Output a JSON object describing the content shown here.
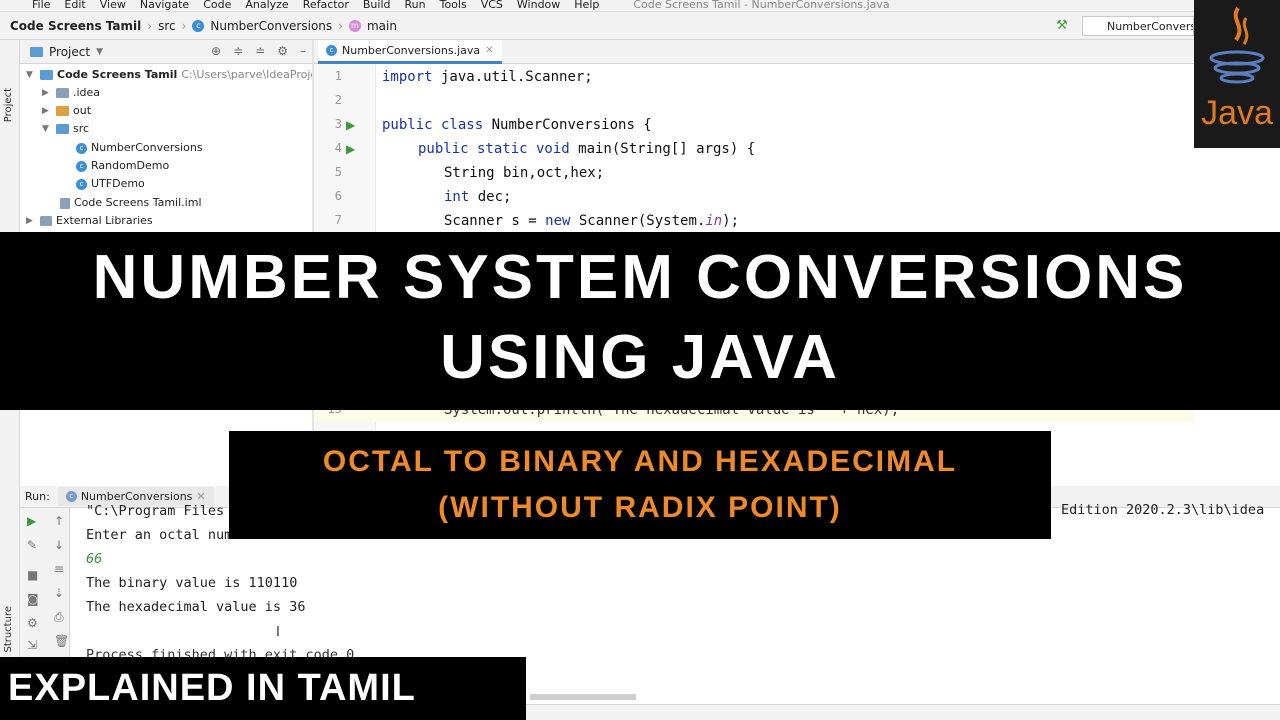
{
  "menu": {
    "items": [
      "File",
      "Edit",
      "View",
      "Navigate",
      "Code",
      "Analyze",
      "Refactor",
      "Build",
      "Run",
      "Tools",
      "VCS",
      "Window",
      "Help"
    ],
    "window_title": "Code Screens Tamil - NumberConversions.java"
  },
  "breadcrumb": {
    "project": "Code Screens Tamil",
    "src": "src",
    "class": "NumberConversions",
    "method": "main"
  },
  "run_config": "NumberConversions",
  "project_panel": {
    "title": "Project",
    "root": {
      "name": "Code Screens Tamil",
      "path": "C:\\Users\\parve\\IdeaProjects\\Co"
    },
    "items": [
      ".idea",
      "out",
      "src",
      "NumberConversions",
      "RandomDemo",
      "UTFDemo",
      "Code Screens Tamil.iml",
      "External Libraries"
    ]
  },
  "editor": {
    "tab": "NumberConversions.java",
    "line_numbers": [
      "1",
      "2",
      "3",
      "4",
      "5",
      "6",
      "7"
    ],
    "line15": "15",
    "code": {
      "l1a": "import",
      "l1b": " java.util.Scanner;",
      "l3a": "public class",
      "l3b": " NumberConversions {",
      "l4a": "public static void",
      "l4b": " main(String[] args) {",
      "l5": "String bin,oct,hex;",
      "l6a": "int",
      "l6b": " dec;",
      "l7a": "Scanner s = ",
      "l7b": "new",
      "l7c": " Scanner(System.",
      "l7d": "in",
      "l7e": ");",
      "l15": "System.out.println(\"The hexadecimal value is \" + hex);"
    }
  },
  "java_logo_text": "Java",
  "banner": {
    "line1": "NUMBER SYSTEM CONVERSIONS",
    "line2": "USING JAVA"
  },
  "subtitle": {
    "line1": "OCTAL TO BINARY AND HEXADECIMAL",
    "line2": "(WITHOUT RADIX POINT)"
  },
  "run_panel": {
    "label": "Run:",
    "tab": "NumberConversions",
    "side_labels": [
      "Structure",
      "ites"
    ],
    "console": [
      "\"C:\\Program Files",
      "Enter an octal number:",
      "66",
      "The binary value is 110110",
      "The hexadecimal value is 36",
      "",
      "Process finished with exit code 0"
    ],
    "edition_tail": "Edition 2020.2.3\\lib\\idea"
  },
  "footer_banner": "EXPLAINED IN TAMIL"
}
